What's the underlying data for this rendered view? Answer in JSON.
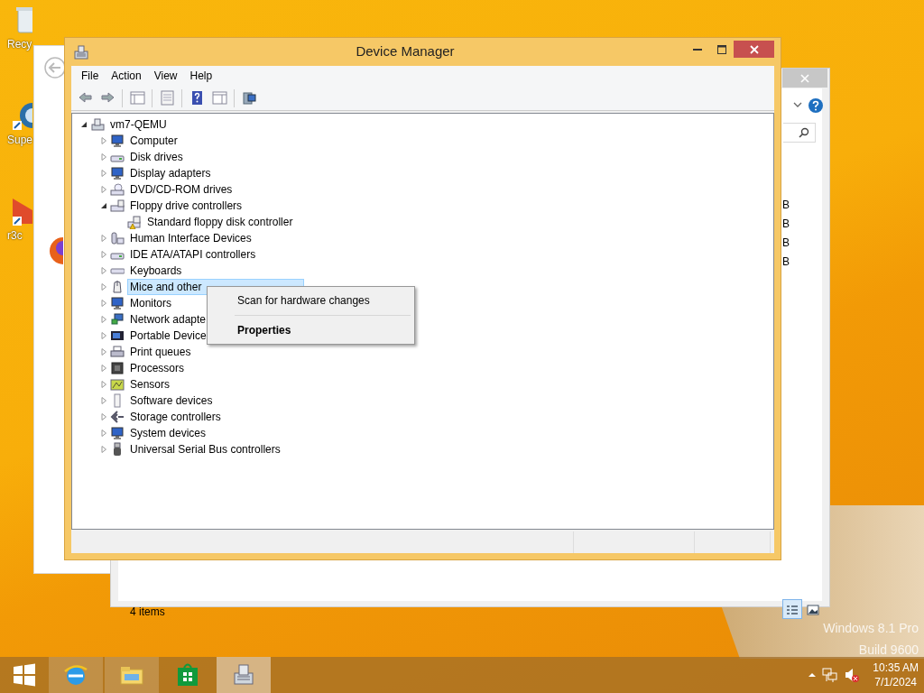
{
  "desktop_icons": [
    {
      "label": "Recy"
    },
    {
      "label": "Supe"
    },
    {
      "label": "r3c"
    }
  ],
  "explorer_window": {
    "size_column": [
      "B",
      "B",
      "B",
      "B"
    ],
    "status": "4 items",
    "views": [
      {
        "selected": true
      },
      {
        "selected": false
      }
    ]
  },
  "device_manager": {
    "title": "Device Manager",
    "menu": [
      "File",
      "Action",
      "View",
      "Help"
    ],
    "tree": {
      "label": "vm7-QEMU",
      "expanded": true,
      "children": [
        {
          "label": "Computer",
          "expanded": false,
          "selected": false
        },
        {
          "label": "Disk drives",
          "expanded": false,
          "selected": false
        },
        {
          "label": "Display adapters",
          "expanded": false,
          "selected": false
        },
        {
          "label": "DVD/CD-ROM drives",
          "expanded": false,
          "selected": false
        },
        {
          "label": "Floppy drive controllers",
          "expanded": true,
          "selected": false,
          "children": [
            {
              "label": "Standard floppy disk controller",
              "selected": false
            }
          ]
        },
        {
          "label": "Human Interface Devices",
          "expanded": false,
          "selected": false
        },
        {
          "label": "IDE ATA/ATAPI controllers",
          "expanded": false,
          "selected": false
        },
        {
          "label": "Keyboards",
          "expanded": false,
          "selected": false
        },
        {
          "label": "Mice and other",
          "expanded": false,
          "selected": true
        },
        {
          "label": "Monitors",
          "expanded": false,
          "selected": false
        },
        {
          "label": "Network adapte",
          "expanded": false,
          "selected": false
        },
        {
          "label": "Portable Device",
          "expanded": false,
          "selected": false
        },
        {
          "label": "Print queues",
          "expanded": false,
          "selected": false
        },
        {
          "label": "Processors",
          "expanded": false,
          "selected": false
        },
        {
          "label": "Sensors",
          "expanded": false,
          "selected": false
        },
        {
          "label": "Software devices",
          "expanded": false,
          "selected": false
        },
        {
          "label": "Storage controllers",
          "expanded": false,
          "selected": false
        },
        {
          "label": "System devices",
          "expanded": false,
          "selected": false
        },
        {
          "label": "Universal Serial Bus controllers",
          "expanded": false,
          "selected": false
        }
      ]
    }
  },
  "context_menu": [
    {
      "label": "Scan for hardware changes",
      "default": false
    },
    {
      "label": "Properties",
      "default": true
    }
  ],
  "os_edition": [
    "Windows 8.1 Pro",
    "Build 9600"
  ],
  "taskbar": {
    "apps": [
      {
        "selected": false
      },
      {
        "selected": false
      },
      {
        "selected": false
      },
      {
        "selected": true
      }
    ],
    "time": "10:35 AM",
    "date": "7/1/2024"
  }
}
